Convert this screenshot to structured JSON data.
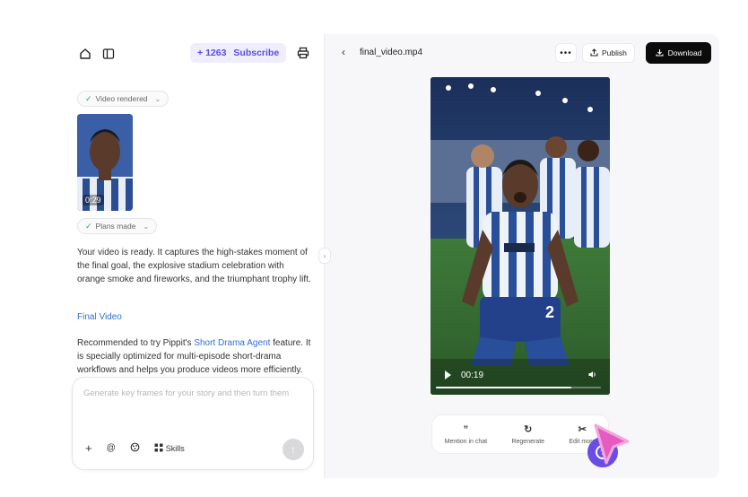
{
  "left_panel": {
    "credits": "1263",
    "subscribe_label": "Subscribe",
    "pill_video": "Video rendered",
    "thumb_duration": "0:29",
    "pill_plans": "Plans made",
    "message_1": "Your video is ready. It captures the high-stakes moment of the final goal, the explosive stadium celebration with orange smoke and fireworks, and the triumphant trophy lift.",
    "final_video_link": "Final Video",
    "rec_prefix": "Recommended to try Pippit's ",
    "rec_link": "Short Drama Agent",
    "rec_suffix": " feature. It is specially optimized for multi-episode short-drama workflows and helps you produce videos more efficiently.",
    "composer_placeholder": "Generate key frames for your story and then turn them",
    "skills_label": "Skills"
  },
  "right_panel": {
    "filename": "final_video.mp4",
    "more_label": "•••",
    "publish_label": "Publish",
    "download_label": "Download",
    "video_time": "00:19",
    "video_progress": 0.82,
    "actions": [
      {
        "icon": "quote-icon",
        "glyph": "”",
        "label": "Mention in chat"
      },
      {
        "icon": "refresh-icon",
        "glyph": "↻",
        "label": "Regenerate"
      },
      {
        "icon": "scissors-icon",
        "glyph": "✂",
        "label": "Edit more"
      }
    ]
  },
  "colors": {
    "accent": "#5b4ce6",
    "link": "#2f6fd6",
    "help_button": "#6a4ce6",
    "cursor": "#e55bc0",
    "download_bg": "#0b0b0b"
  }
}
